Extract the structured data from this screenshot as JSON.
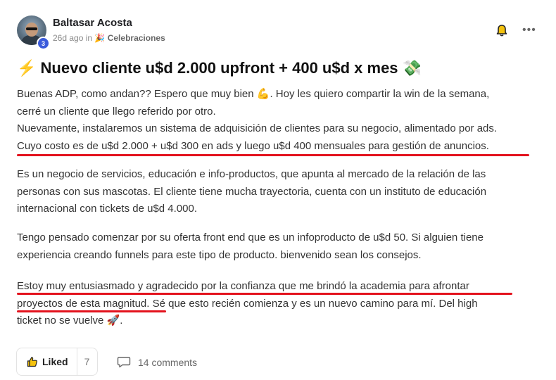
{
  "post": {
    "author": "Baltasar Acosta",
    "level": "3",
    "time_ago": "26d ago",
    "in_word": "in",
    "category_emoji": "🎉",
    "category": "Celebraciones",
    "title_emoji": "⚡",
    "title": "Nuevo cliente u$d 2.000 upfront + 400 u$d x mes",
    "title_end_emoji": "💸",
    "paragraphs": [
      [
        "Buenas ADP, como andan?? Espero que muy bien 💪. Hoy les quiero compartir la win de la semana,",
        "cerré un cliente que llego referido por otro.",
        "Nuevamente, instalaremos un sistema de adquisición de clientes para su negocio, alimentado por ads.",
        "Cuyo costo es de u$d 2.000 + u$d 300 en ads y luego u$d 400 mensuales para gestión de anuncios."
      ],
      [
        "Es un negocio de servicios, educación e info-productos, que apunta al mercado de la relación de las",
        "personas con sus mascotas. El cliente tiene mucha trayectoria, cuenta con un instituto de educación",
        "internacional con tickets de u$d 4.000."
      ],
      [
        "Tengo pensado comenzar por su oferta front end que es un infoproducto de u$d 50. Si alguien tiene",
        "experiencia creando funnels para este tipo de producto. bienvenido sean los consejos."
      ],
      [
        "Estoy muy entusiasmado y agradecido por la confianza que me brindó la academia para afrontar",
        "proyectos de esta magnitud. Sé que esto recién comienza y es un nuevo camino para mí. Del high",
        "ticket no se vuelve 🚀."
      ]
    ]
  },
  "actions": {
    "like_label": "Liked",
    "like_count": "7",
    "comments_label": "14 comments"
  },
  "colors": {
    "highlight_underline": "#e3121d",
    "badge": "#3b5bdb"
  },
  "icons": [
    "bell-icon",
    "more-icon",
    "thumbs-up-icon",
    "comment-icon"
  ]
}
